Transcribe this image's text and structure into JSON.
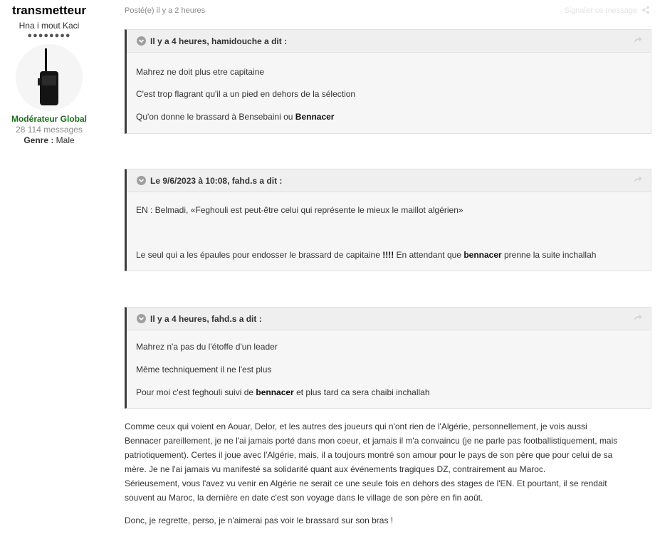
{
  "author": {
    "name": "transmetteur",
    "title": "Hna i mout Kaci",
    "rank_pips": "●●●●●●●●",
    "group": "Modérateur Global",
    "posts": "28 114 messages",
    "genre_label": "Genre :",
    "genre_value": "Male"
  },
  "post": {
    "posted": "Posté(e) il y a 2 heures",
    "report": "Signaler ce message",
    "share_icon": "share-icon"
  },
  "quotes": [
    {
      "header": "Il y a 4 heures, hamidouche a dit :",
      "lines": [
        "Mahrez ne doit plus etre capitaine",
        "C'est trop flagrant qu'il a un pied en dehors de la sélection"
      ],
      "line3_pre": "Qu'on donne le brassard à Bensebaini ou ",
      "line3_bold": "Bennacer"
    },
    {
      "header": "Le 9/6/2023 à 10:08, fahd.s a dit :",
      "line1": "EN : Belmadi, «Feghouli est peut-être celui qui représente le mieux le maillot algérien»",
      "line2_pre": "Le seul qui a les épaules pour endosser le brassard de capitaine ",
      "line2_bold1": "!!!!",
      "line2_mid": " En attendant que ",
      "line2_bold2": "bennacer",
      "line2_post": " prenne la suite inchallah"
    },
    {
      "header": "Il y a 4 heures, fahd.s a dit :",
      "line1": "Mahrez n'a pas du l'étoffe d'un leader",
      "line2": "Même techniquement il ne l'est plus",
      "line3_pre": "Pour moi c'est feghouli suivi de ",
      "line3_bold": "bennacer",
      "line3_post": " et plus tard ca sera chaibi inchallah"
    }
  ],
  "body": {
    "para1": [
      "Comme ceux qui voient en Aouar, Delor, et les autres des joueurs qui n'ont rien de l'Algérie, personnellement, je vois aussi",
      "Bennacer pareillement, je ne l'ai jamais porté dans mon coeur, et jamais il m'a convaincu (je ne parle pas footballistiquement, mais",
      "patriotiquement). Certes il joue avec l'Algérie, mais, il a toujours montré son amour pour le pays de son père que pour celui de sa",
      "mère. Je ne l'ai jamais vu manifesté sa solidarité quant aux événements tragiques DZ, contrairement au Maroc.",
      "Sérieusement, vous l'avez vu venir en Algérie ne serait ce une seule fois en dehors des stages de l'EN. Et pourtant, il se rendait",
      "souvent au Maroc, la dernière en date c'est son voyage dans le village de son père en fin août."
    ],
    "para2": "Donc, je regrette, perso, je n'aimerai pas voir le brassard sur son bras !"
  }
}
